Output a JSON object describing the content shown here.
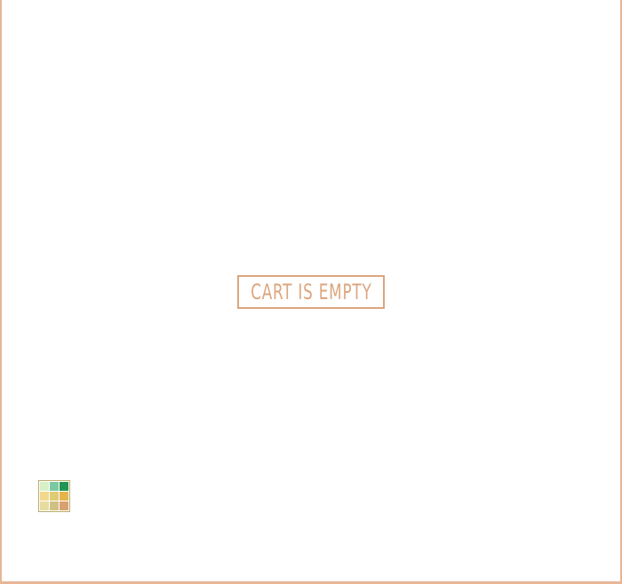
{
  "cart": {
    "empty_message": "CART IS EMPTY"
  },
  "palette": {
    "icon": "palette-grid-icon",
    "swatches": [
      "#d8f0c6",
      "#7cc9a1",
      "#239653",
      "#f0d98d",
      "#dfcc74",
      "#e3b54c",
      "#e6dca1",
      "#d1c083",
      "#d9a070"
    ]
  },
  "colors": {
    "accent": "#dca57e",
    "frame": "#e8b696"
  }
}
